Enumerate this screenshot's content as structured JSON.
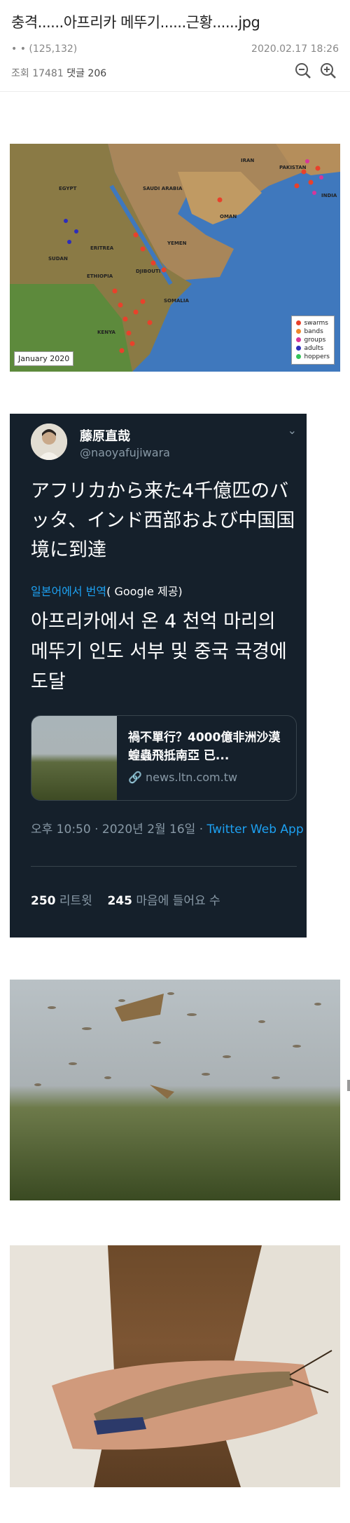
{
  "post": {
    "title": "충격......아프리카 메뚜기......근황......jpg",
    "author_info": "• • (125,132)",
    "date": "2020.02.17 18:26",
    "views_label": "조회 17481",
    "comments_label": "댓글 206"
  },
  "map": {
    "caption": "January 2020",
    "legend": [
      {
        "label": "swarms",
        "color": "#e8412b"
      },
      {
        "label": "bands",
        "color": "#f0882a"
      },
      {
        "label": "groups",
        "color": "#d6369a"
      },
      {
        "label": "adults",
        "color": "#2d2dbb"
      },
      {
        "label": "hoppers",
        "color": "#33c45a"
      }
    ],
    "labels": [
      "EGYPT",
      "SAUDI ARABIA",
      "OMAN",
      "YEMEN",
      "SUDAN",
      "ERITREA",
      "ETHIOPIA",
      "DJIBOUTI",
      "SOMALIA",
      "KENYA",
      "PAKISTAN",
      "INDIA",
      "IRAN"
    ]
  },
  "tweet": {
    "name": "藤原直哉",
    "handle": "@naoyafujiwara",
    "text_jp": "アフリカから来た4千億匹のバッタ、インド西部および中国国境に到達",
    "translated_link": "일본어에서 번역",
    "translated_by": "( Google 제공)",
    "text_ko": "아프리카에서 온 4 천억 마리의 메뚜기 인도 서부 및 중국 국경에 도달",
    "card_title": "禍不單行？4000億非洲沙漠蝗蟲飛抵南亞 已...",
    "card_domain": "news.ltn.com.tw",
    "time": "오후 10:50 · 2020년 2월 16일 · ",
    "source": "Twitter Web App",
    "retweets": "250",
    "retweets_label": "리트윗",
    "likes": "245",
    "likes_label": "마음에 들어요 수"
  }
}
